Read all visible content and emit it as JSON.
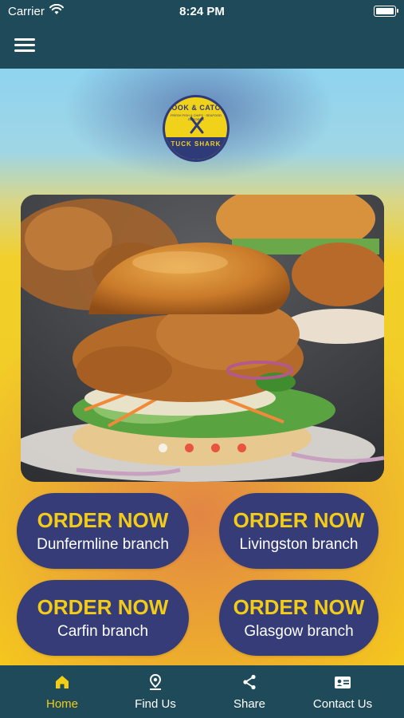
{
  "status_bar": {
    "carrier": "Carrier",
    "time": "8:24 PM"
  },
  "app_bar": {
    "menu_icon": "hamburger-menu-icon"
  },
  "logo": {
    "top_text": "HOOK & CATCH",
    "sub_text": "FRESH FISH & CHIPS · SEAFOOD BURGERS",
    "bottom_text": "TUCK SHARK"
  },
  "carousel": {
    "slide_count": 4,
    "active_index": 0
  },
  "orders": [
    {
      "title": "ORDER NOW",
      "branch": "Dunfermline branch"
    },
    {
      "title": "ORDER NOW",
      "branch": "Livingston branch"
    },
    {
      "title": "ORDER NOW",
      "branch": "Carfin branch"
    },
    {
      "title": "ORDER NOW",
      "branch": "Glasgow branch"
    }
  ],
  "tabs": [
    {
      "label": "Home",
      "icon": "home-icon",
      "active": true
    },
    {
      "label": "Find Us",
      "icon": "location-pin-icon",
      "active": false
    },
    {
      "label": "Share",
      "icon": "share-icon",
      "active": false
    },
    {
      "label": "Contact Us",
      "icon": "contact-card-icon",
      "active": false
    }
  ],
  "colors": {
    "header": "#1f4a59",
    "button": "#353c78",
    "accent": "#f2cc17",
    "dot": "#e8543e"
  }
}
